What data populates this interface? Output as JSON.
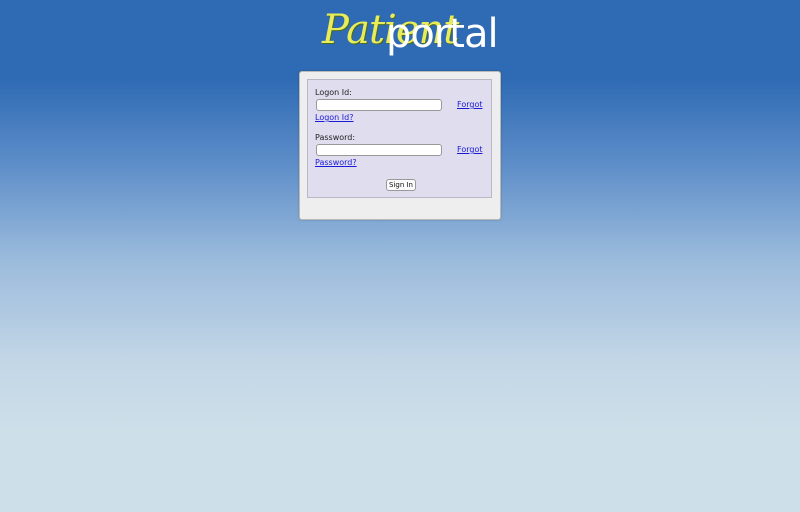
{
  "logo": {
    "patient": "Patient",
    "portal": "portal"
  },
  "login": {
    "logon_label": "Logon Id:",
    "logon_value": "",
    "forgot_logon_a": "Forgot",
    "forgot_logon_b": "Logon Id?",
    "password_label": "Password:",
    "password_value": "",
    "forgot_password_a": "Forgot",
    "forgot_password_b": "Password?",
    "signin_label": "Sign In"
  },
  "colors": {
    "header_blue": "#2f6bb4",
    "bottom_blue": "#cddfe9",
    "panel_bg": "#e0ddef",
    "link": "#1a1ad6",
    "logo_yellow": "#e9ec5a"
  }
}
